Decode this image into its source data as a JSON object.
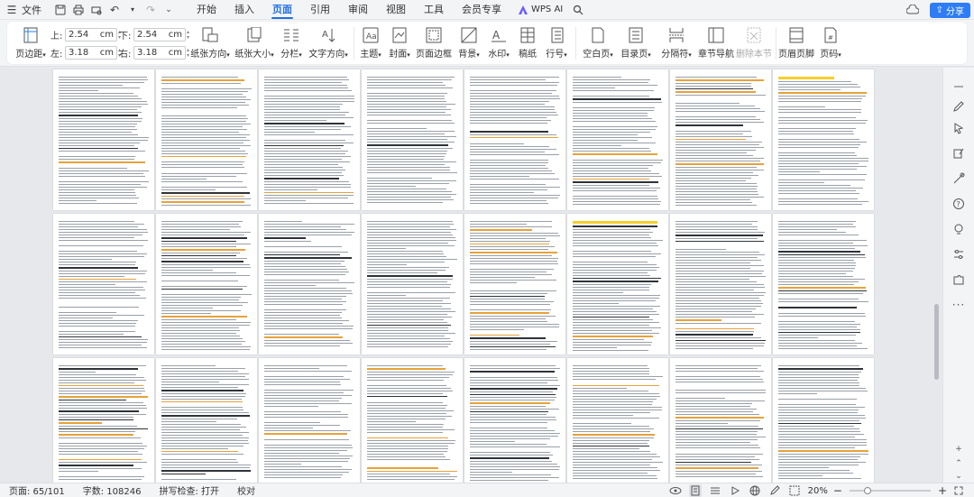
{
  "titlebar": {
    "file_label": "文件",
    "menu": [
      "开始",
      "插入",
      "页面",
      "引用",
      "审阅",
      "视图",
      "工具",
      "会员专享"
    ],
    "active_menu": "页面",
    "ai_label": "WPS AI",
    "share_label": "分享"
  },
  "ribbon": {
    "margins": {
      "top_label": "上:",
      "top_value": "2.54",
      "top_unit": "cm",
      "bottom_label": "下:",
      "bottom_value": "2.54",
      "bottom_unit": "cm",
      "left_label": "左:",
      "left_value": "3.18",
      "left_unit": "cm",
      "right_label": "右:",
      "right_value": "3.18",
      "right_unit": "cm"
    },
    "buttons": {
      "margin": "页边距",
      "orientation": "纸张方向",
      "size": "纸张大小",
      "columns": "分栏",
      "text_direction": "文字方向",
      "theme": "主题",
      "cover": "封面",
      "border": "页面边框",
      "background": "背景",
      "watermark": "水印",
      "manuscript": "稿纸",
      "line_numbers": "行号",
      "blank_page": "空白页",
      "toc_page": "目录页",
      "separator": "分隔符",
      "chapter_nav": "章节导航",
      "delete_section": "删除本节",
      "header_footer": "页眉页脚",
      "page_number": "页码"
    }
  },
  "status": {
    "page": "页面: 65/101",
    "words": "字数: 108246",
    "spell": "拼写检查: 打开",
    "proof": "校对",
    "zoom": "20%",
    "zoom_level": 0.2
  },
  "icons": {
    "sidebar": [
      "minus-icon",
      "pen-icon",
      "cursor-icon",
      "edit-icon",
      "tools-icon",
      "help-icon",
      "lightbulb-icon",
      "sliders-icon",
      "puzzle-icon",
      "more-icon"
    ]
  }
}
